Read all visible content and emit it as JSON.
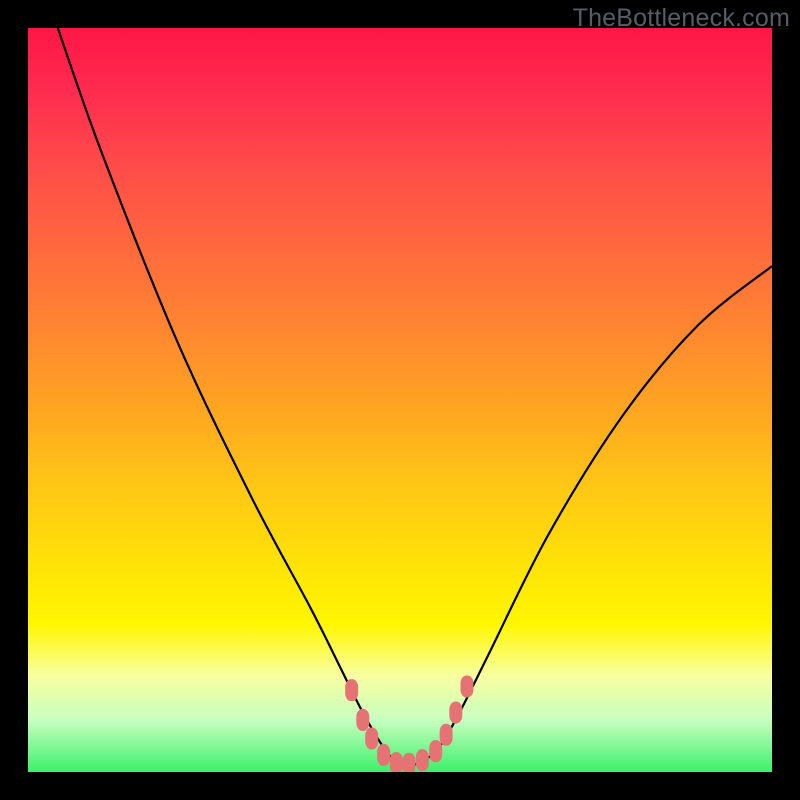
{
  "watermark": "TheBottleneck.com",
  "chart_data": {
    "type": "line",
    "title": "",
    "xlabel": "",
    "ylabel": "",
    "xlim": [
      0,
      100
    ],
    "ylim": [
      0,
      100
    ],
    "series": [
      {
        "name": "curve",
        "x": [
          4,
          10,
          20,
          30,
          38,
          42,
          45,
          48,
          50,
          52,
          55,
          58,
          62,
          70,
          80,
          90,
          100
        ],
        "y": [
          100,
          83,
          58,
          37,
          22,
          14,
          8,
          3,
          1,
          1,
          3,
          8,
          16,
          32,
          48,
          60,
          68
        ]
      }
    ],
    "markers": [
      {
        "x": 43.5,
        "y": 11
      },
      {
        "x": 45.0,
        "y": 7
      },
      {
        "x": 46.2,
        "y": 4.5
      },
      {
        "x": 47.8,
        "y": 2.3
      },
      {
        "x": 49.5,
        "y": 1.2
      },
      {
        "x": 51.2,
        "y": 1.1
      },
      {
        "x": 53.0,
        "y": 1.6
      },
      {
        "x": 54.8,
        "y": 2.8
      },
      {
        "x": 56.2,
        "y": 5.0
      },
      {
        "x": 57.5,
        "y": 8.0
      },
      {
        "x": 59.0,
        "y": 11.5
      }
    ]
  }
}
